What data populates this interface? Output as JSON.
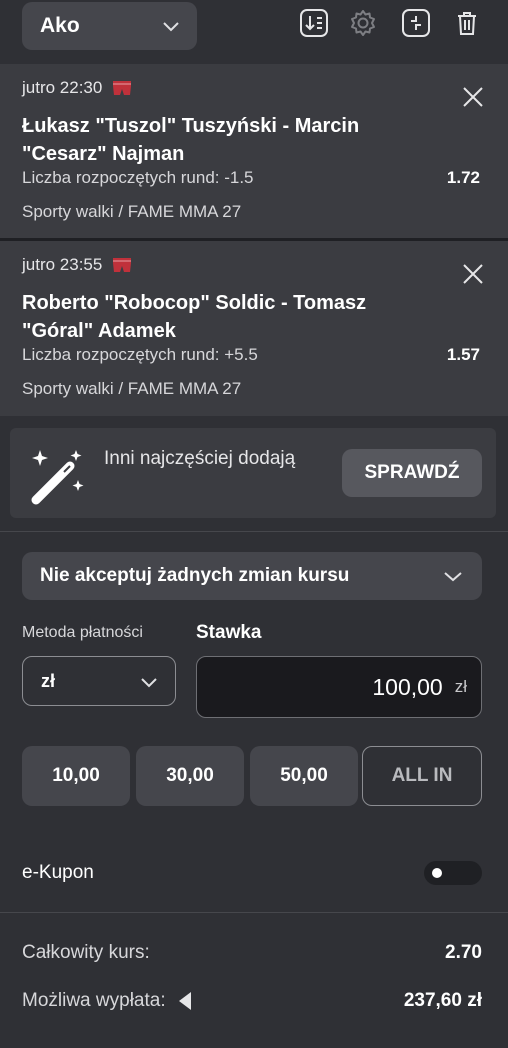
{
  "header": {
    "bet_type": "Ako",
    "tools": [
      "sort-icon",
      "gear-icon",
      "expand-icon",
      "trash-icon"
    ]
  },
  "events": [
    {
      "time": "jutro 22:30",
      "title": "Łukasz \"Tuszol\" Tuszyński - Marcin \"Cesarz\" Najman",
      "market": "Liczba rozpoczętych rund: -1.5",
      "odds": "1.72",
      "league": "Sporty walki / FAME MMA 27"
    },
    {
      "time": "jutro 23:55",
      "title": "Roberto \"Robocop\" Soldic - Tomasz \"Góral\" Adamek",
      "market": "Liczba rozpoczętych rund: +5.5",
      "odds": "1.57",
      "league": "Sporty walki / FAME MMA 27"
    }
  ],
  "promo": {
    "text": "Inni najczęściej dodają",
    "button": "SPRAWDŹ"
  },
  "odds_change": {
    "selected": "Nie akceptuj żadnych zmian kursu"
  },
  "payment": {
    "method_label": "Metoda płatności",
    "currency": "zł",
    "stake_label": "Stawka",
    "stake_value": "100,00",
    "stake_unit": "zł"
  },
  "quick_stakes": [
    "10,00",
    "30,00",
    "50,00"
  ],
  "all_in": "ALL IN",
  "ekupon": {
    "label": "e-Kupon",
    "enabled": false
  },
  "summary": {
    "total_odds_label": "Całkowity kurs:",
    "total_odds": "2.70",
    "payout_label": "Możliwa wypłata:",
    "payout": "237,60 zł"
  },
  "colors": {
    "background": "#2f3035",
    "card": "#3b3c41",
    "button": "#45464c",
    "flag_red": "#c0313b"
  }
}
